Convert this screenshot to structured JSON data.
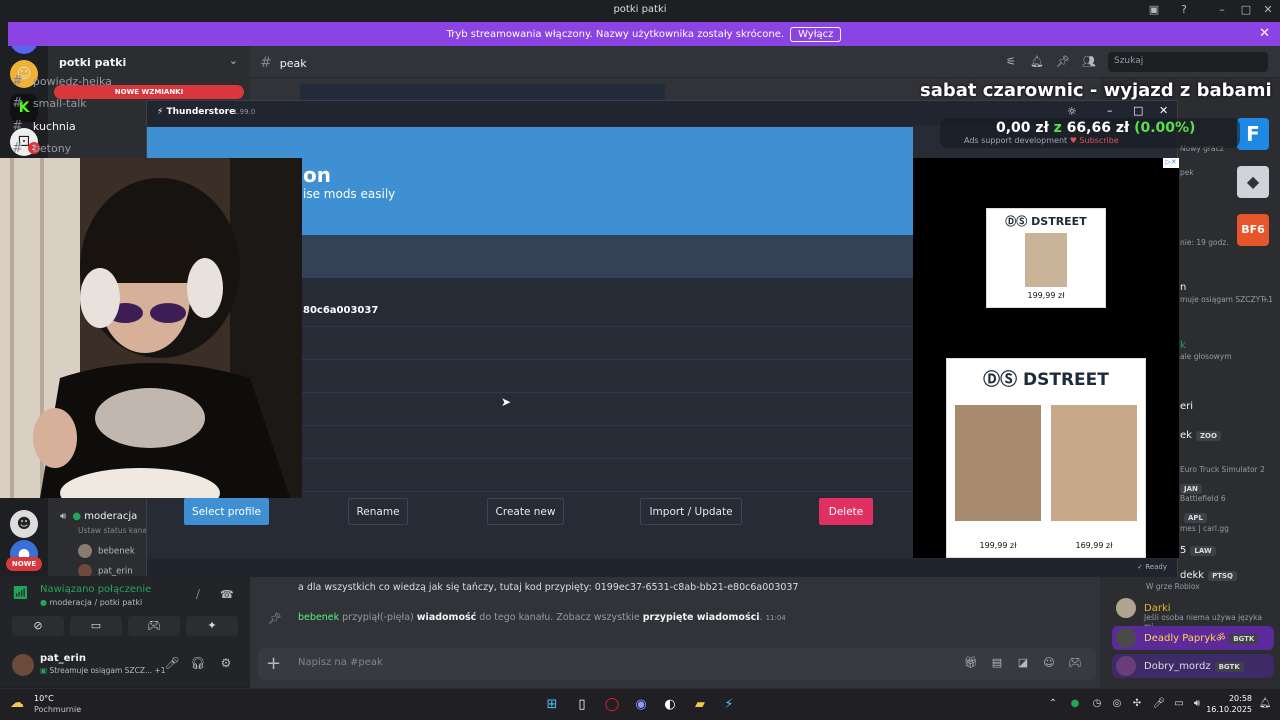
{
  "window": {
    "title": "potki patki"
  },
  "banner": {
    "text": "Tryb streamowania włączony. Nazwy użytkownika zostały skrócone.",
    "button": "Wyłącz"
  },
  "server": {
    "name": "potki patki"
  },
  "channels": [
    {
      "name": "powiedz-hejka"
    },
    {
      "name": "small-talk"
    },
    {
      "name": "kuchnia"
    },
    {
      "name": "betony"
    }
  ],
  "new_mentions": "NOWE WZMIANKI",
  "new_badge": "NOWE",
  "server_badge": "2",
  "voice_channel": {
    "name": "moderacja",
    "status_hint": "Ustaw status kanału",
    "users": [
      "bebenek",
      "pat_erin"
    ]
  },
  "chat": {
    "channel": "peak",
    "search_placeholder": "Szukaj",
    "message1": "a dla wszystkich co wiedzą jak się tańczy, tutaj kod przypięty: 0199ec37-6531-c8ab-bb21-e80c6a003037",
    "pin_user": "bebenek",
    "pin_text1": " przypiął(-pięła) ",
    "pin_word": "wiadomość",
    "pin_text2": " do tego kanału. Zobacz wszystkie ",
    "pin_link": "przypięte wiadomości",
    "pin_dot": ".",
    "pin_time": "11:04",
    "composer_placeholder": "Napisz na #peak"
  },
  "voice": {
    "connected": "Nawiązano połączenie",
    "location": "moderacja / potki patki"
  },
  "user": {
    "name": "pat_erin",
    "status": "Streamuje osiągam SZCZ...",
    "extra": "+1"
  },
  "thunderstore": {
    "name": "Thunderstore",
    "version": "1.99.0",
    "hero_title": "on",
    "hero_sub": "ise mods easily",
    "code": "80c6a003037",
    "buttons": [
      "Select profile",
      "Rename",
      "Create new",
      "Import / Update",
      "Delete"
    ],
    "status": "Ready"
  },
  "ads": {
    "brand": "DSTREET",
    "price1": "199,99 zł",
    "price2": "199,99 zł",
    "price3": "169,99 zł"
  },
  "overlay": {
    "title": "sabat czarownic - wyjazd z babami",
    "amount": "0,00 zł",
    "z": "z",
    "goal": "66,66 zł",
    "pct": "(0.00%)",
    "support": "Ads support development",
    "subscribe": "Subscribe"
  },
  "members": {
    "nowy_gracz": "Nowy gracz",
    "peak": "pek",
    "hours": "nie: 19 godz.",
    "m_n": "n",
    "stream_line": "muje osiągam SZCZYT...",
    "plus1": "+1",
    "m_k": "k",
    "voice_line": "ale głosowym",
    "m_eri": "eri",
    "m_ek": "ek",
    "zoo": "ZOO",
    "ets": "Euro Truck Simulator 2",
    "jan": "JAN",
    "bf6": "Battlefield 6",
    "apl": "APL",
    "carl": "mes | carl.gg",
    "m_5": "5",
    "law": "LAW",
    "dekk": "dekk",
    "ptsq": "PTSQ",
    "roblox": "W grze Roblox",
    "darki": "Darki",
    "darki_sub": "Jeśli osoba niema używa języka mi...",
    "paprik": "Deadly Paprykॐ",
    "bgtk": "BGTK",
    "dobry": "Dobry_mordz",
    "bgtk2": "BGTK"
  },
  "taskbar": {
    "temp": "10°C",
    "weather": "Pochmurnie",
    "time": "20:58",
    "date": "16.10.2025"
  },
  "colors": {
    "accent": "#8b43e3",
    "ts_blue": "#3e90d2",
    "delete": "#e03062",
    "select": "#3e90d2"
  }
}
